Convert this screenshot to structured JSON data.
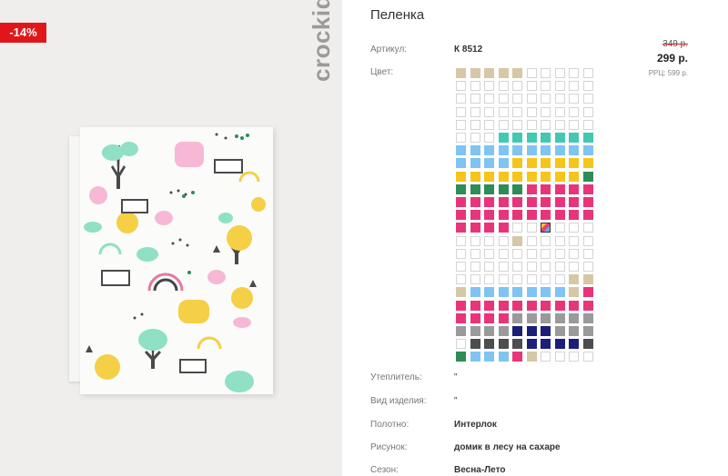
{
  "badge": {
    "discount": "-14%"
  },
  "brand": {
    "logo_text": "crockid"
  },
  "product": {
    "title": "Пеленка",
    "article_label": "Артикул:",
    "article_value": "К 8512",
    "color_label": "Цвет:",
    "old_price": "349 р.",
    "price": "299 р.",
    "rrp": "РРЦ: 599 р."
  },
  "specs": [
    {
      "label": "Утеплитель:",
      "value": "\""
    },
    {
      "label": "Вид изделия:",
      "value": "\""
    },
    {
      "label": "Полотно:",
      "value": "Интерлок"
    },
    {
      "label": "Рисунок:",
      "value": "домик в лесу на сахаре"
    },
    {
      "label": "Сезон:",
      "value": "Весна-Лето"
    }
  ],
  "colors": {
    "beige": "#d6c7a6",
    "teal": "#43c8b4",
    "sky": "#7fc4f2",
    "yellow": "#f5c51c",
    "green": "#2e8c57",
    "pink": "#e8357a",
    "gray": "#9a9a9a",
    "dark": "#4d4d4d",
    "navy": "#1b1f7a",
    "discount_red": "#e1161b"
  },
  "swatch_rows": [
    "bbbbb.....",
    "..........",
    "..........",
    "..........",
    "..........",
    "...ttttttt",
    "ssssssssss",
    "ssssyyyyyy",
    "yyyyyyyyyg",
    "gggggppppp",
    "pppppppppp",
    "pppppppppp",
    "pppp..X...",
    "....b.....",
    "..........",
    "..........",
    "........bb",
    "bsssssssbp",
    "pppppppppp",
    "pppprrrrrr",
    "rrrrnnnrrr",
    ".ddddnnnnd",
    "gssspb...."
  ]
}
